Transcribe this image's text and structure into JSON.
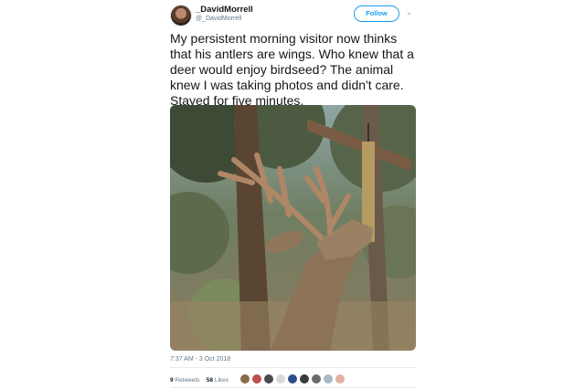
{
  "tweet": {
    "display_name": "_DavidMorrell",
    "handle": "@_DavidMorrell",
    "follow_label": "Follow",
    "caret": "⌄",
    "text": "My persistent morning visitor now thinks that his antlers are wings. Who knew that a deer would enjoy birdseed? The animal knew I was taking photos and didn't care. Stayed for five minutes.",
    "timestamp": "7:37 AM - 3 Oct 2018",
    "retweets_count": "9",
    "retweets_label": "Retweets",
    "likes_count": "58",
    "likes_label": "Likes"
  },
  "colors": {
    "accent": "#1da1f2",
    "secondary_text": "#657786",
    "primary_text": "#14171a"
  },
  "icons": [
    "chevron-down-icon",
    "avatar-image",
    "deer-photo"
  ],
  "likers": [
    {
      "name": "liker-avatar-1",
      "color": "#8a6a4a"
    },
    {
      "name": "liker-avatar-2",
      "color": "#c0504d"
    },
    {
      "name": "liker-avatar-3",
      "color": "#4a4a4a"
    },
    {
      "name": "liker-avatar-4",
      "color": "#d9d9d9"
    },
    {
      "name": "liker-avatar-5",
      "color": "#2e4e8c"
    },
    {
      "name": "liker-avatar-6",
      "color": "#3b3b3b"
    },
    {
      "name": "liker-avatar-7",
      "color": "#6b6b6b"
    },
    {
      "name": "liker-avatar-8",
      "color": "#a9b8c9"
    },
    {
      "name": "liker-avatar-9",
      "color": "#e0b2a0"
    }
  ]
}
